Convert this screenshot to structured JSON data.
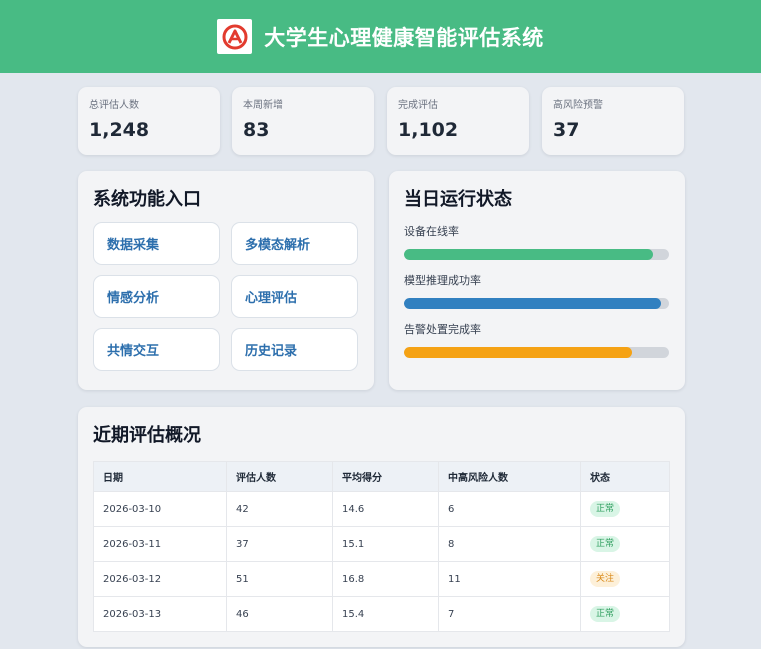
{
  "header": {
    "title": "大学生心理健康智能评估系统"
  },
  "stats": [
    {
      "label": "总评估人数",
      "value": "1,248"
    },
    {
      "label": "本周新增",
      "value": "83"
    },
    {
      "label": "完成评估",
      "value": "1,102"
    },
    {
      "label": "高风险预警",
      "value": "37"
    }
  ],
  "functions": {
    "title": "系统功能入口",
    "items": [
      "数据采集",
      "多模态解析",
      "情感分析",
      "心理评估",
      "共情交互",
      "历史记录"
    ]
  },
  "status": {
    "title": "当日运行状态",
    "metrics": [
      {
        "label": "设备在线率",
        "percent": 94,
        "color": "#48bb84"
      },
      {
        "label": "模型推理成功率",
        "percent": 97,
        "color": "#3180c0"
      },
      {
        "label": "告警处置完成率",
        "percent": 86,
        "color": "#f5a214"
      }
    ]
  },
  "recent": {
    "title": "近期评估概况",
    "columns": [
      "日期",
      "评估人数",
      "平均得分",
      "中高风险人数",
      "状态"
    ],
    "rows": [
      {
        "date": "2026-03-10",
        "count": "42",
        "avg": "14.6",
        "risk": "6",
        "status": "正常",
        "status_type": "ok"
      },
      {
        "date": "2026-03-11",
        "count": "37",
        "avg": "15.1",
        "risk": "8",
        "status": "正常",
        "status_type": "ok"
      },
      {
        "date": "2026-03-12",
        "count": "51",
        "avg": "16.8",
        "risk": "11",
        "status": "关注",
        "status_type": "warn"
      },
      {
        "date": "2026-03-13",
        "count": "46",
        "avg": "15.4",
        "risk": "7",
        "status": "正常",
        "status_type": "ok"
      }
    ]
  }
}
